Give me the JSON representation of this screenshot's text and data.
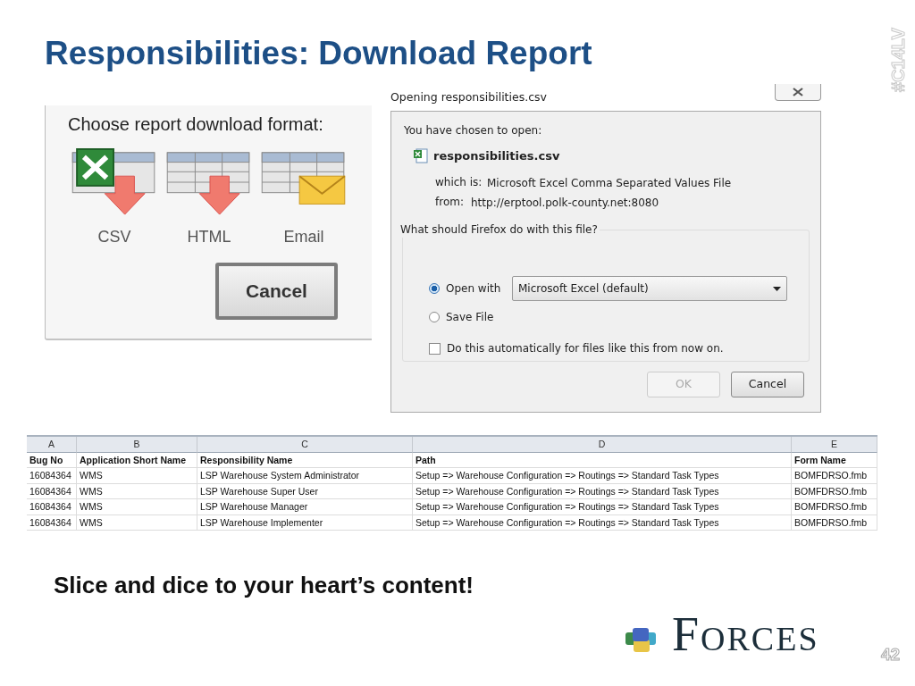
{
  "slide_title": "Responsibilities: Download Report",
  "side_tag": "#C14LV",
  "format_panel": {
    "prompt": "Choose report download format:",
    "options": [
      {
        "label": "CSV",
        "kind": "csv"
      },
      {
        "label": "HTML",
        "kind": "html"
      },
      {
        "label": "Email",
        "kind": "email"
      }
    ],
    "cancel_button": "Cancel"
  },
  "dialog": {
    "title": "Opening responsibilities.csv",
    "intro": "You have chosen to open:",
    "file_name": "responsibilities.csv",
    "details": [
      {
        "label": "which is:",
        "value": "Microsoft Excel Comma Separated Values File"
      },
      {
        "label": "from:",
        "value": "http://erptool.polk-county.net:8080"
      }
    ],
    "group_label": "What should Firefox do with this file?",
    "choices": [
      {
        "label": "Open with",
        "selected": true
      },
      {
        "label": "Save File",
        "selected": false
      }
    ],
    "open_with_app": "Microsoft Excel (default)",
    "auto_checkbox": {
      "label": "Do this automatically for files like this from now on.",
      "checked": false
    },
    "buttons": [
      {
        "label": "OK",
        "disabled": true
      },
      {
        "label": "Cancel",
        "disabled": false
      }
    ]
  },
  "spreadsheet": {
    "column_letters": [
      "A",
      "B",
      "C",
      "D",
      "E"
    ],
    "header": [
      "Bug No",
      "Application Short Name",
      "Responsibility Name",
      "Path",
      "Form Name"
    ],
    "rows": [
      [
        "16084364",
        "WMS",
        "LSP Warehouse System Administrator",
        "Setup => Warehouse Configuration => Routings => Standard Task Types",
        "BOMFDRSO.fmb"
      ],
      [
        "16084364",
        "WMS",
        "LSP Warehouse Super User",
        "Setup => Warehouse Configuration => Routings => Standard Task Types",
        "BOMFDRSO.fmb"
      ],
      [
        "16084364",
        "WMS",
        "LSP Warehouse Manager",
        "Setup => Warehouse Configuration => Routings => Standard Task Types",
        "BOMFDRSO.fmb"
      ],
      [
        "16084364",
        "WMS",
        "LSP Warehouse Implementer",
        "Setup => Warehouse Configuration => Routings => Standard Task Types",
        "BOMFDRSO.fmb"
      ]
    ]
  },
  "caption": "Slice and dice to your heart’s content!",
  "logo_text": "Forces",
  "page_number": "42"
}
